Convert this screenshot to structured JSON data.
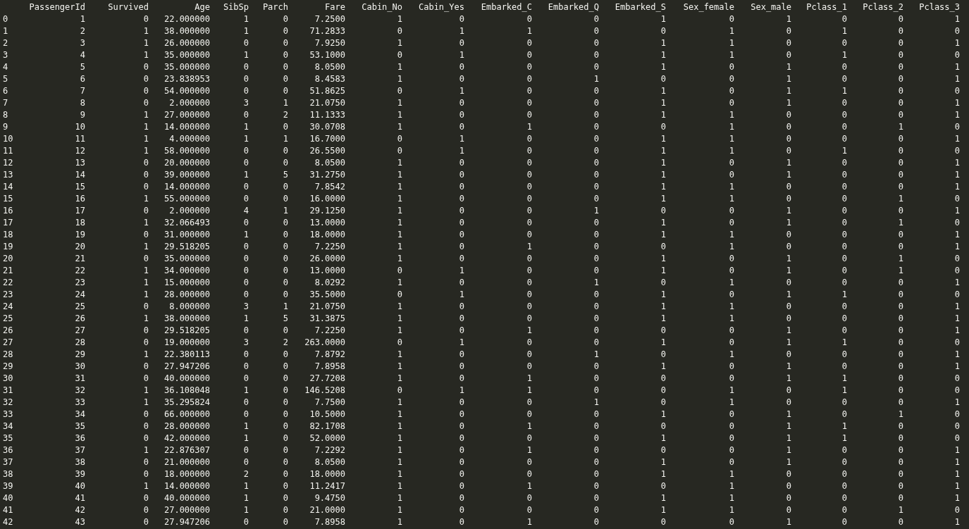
{
  "table": {
    "columns": [
      "PassengerId",
      "Survived",
      "Age",
      "SibSp",
      "Parch",
      "Fare",
      "Cabin_No",
      "Cabin_Yes",
      "Embarked_C",
      "Embarked_Q",
      "Embarked_S",
      "Sex_female",
      "Sex_male",
      "Pclass_1",
      "Pclass_2",
      "Pclass_3"
    ],
    "rows": [
      {
        "index": "0",
        "cells": [
          "1",
          "0",
          "22.000000",
          "1",
          "0",
          "7.2500",
          "1",
          "0",
          "0",
          "0",
          "1",
          "0",
          "1",
          "0",
          "0",
          "1"
        ]
      },
      {
        "index": "1",
        "cells": [
          "2",
          "1",
          "38.000000",
          "1",
          "0",
          "71.2833",
          "0",
          "1",
          "1",
          "0",
          "0",
          "1",
          "0",
          "1",
          "0",
          "0"
        ]
      },
      {
        "index": "2",
        "cells": [
          "3",
          "1",
          "26.000000",
          "0",
          "0",
          "7.9250",
          "1",
          "0",
          "0",
          "0",
          "1",
          "1",
          "0",
          "0",
          "0",
          "1"
        ]
      },
      {
        "index": "3",
        "cells": [
          "4",
          "1",
          "35.000000",
          "1",
          "0",
          "53.1000",
          "0",
          "1",
          "0",
          "0",
          "1",
          "1",
          "0",
          "1",
          "0",
          "0"
        ]
      },
      {
        "index": "4",
        "cells": [
          "5",
          "0",
          "35.000000",
          "0",
          "0",
          "8.0500",
          "1",
          "0",
          "0",
          "0",
          "1",
          "0",
          "1",
          "0",
          "0",
          "1"
        ]
      },
      {
        "index": "5",
        "cells": [
          "6",
          "0",
          "23.838953",
          "0",
          "0",
          "8.4583",
          "1",
          "0",
          "0",
          "1",
          "0",
          "0",
          "1",
          "0",
          "0",
          "1"
        ]
      },
      {
        "index": "6",
        "cells": [
          "7",
          "0",
          "54.000000",
          "0",
          "0",
          "51.8625",
          "0",
          "1",
          "0",
          "0",
          "1",
          "0",
          "1",
          "1",
          "0",
          "0"
        ]
      },
      {
        "index": "7",
        "cells": [
          "8",
          "0",
          "2.000000",
          "3",
          "1",
          "21.0750",
          "1",
          "0",
          "0",
          "0",
          "1",
          "0",
          "1",
          "0",
          "0",
          "1"
        ]
      },
      {
        "index": "8",
        "cells": [
          "9",
          "1",
          "27.000000",
          "0",
          "2",
          "11.1333",
          "1",
          "0",
          "0",
          "0",
          "1",
          "1",
          "0",
          "0",
          "0",
          "1"
        ]
      },
      {
        "index": "9",
        "cells": [
          "10",
          "1",
          "14.000000",
          "1",
          "0",
          "30.0708",
          "1",
          "0",
          "1",
          "0",
          "0",
          "1",
          "0",
          "0",
          "1",
          "0"
        ]
      },
      {
        "index": "10",
        "cells": [
          "11",
          "1",
          "4.000000",
          "1",
          "1",
          "16.7000",
          "0",
          "1",
          "0",
          "0",
          "1",
          "1",
          "0",
          "0",
          "0",
          "1"
        ]
      },
      {
        "index": "11",
        "cells": [
          "12",
          "1",
          "58.000000",
          "0",
          "0",
          "26.5500",
          "0",
          "1",
          "0",
          "0",
          "1",
          "1",
          "0",
          "1",
          "0",
          "0"
        ]
      },
      {
        "index": "12",
        "cells": [
          "13",
          "0",
          "20.000000",
          "0",
          "0",
          "8.0500",
          "1",
          "0",
          "0",
          "0",
          "1",
          "0",
          "1",
          "0",
          "0",
          "1"
        ]
      },
      {
        "index": "13",
        "cells": [
          "14",
          "0",
          "39.000000",
          "1",
          "5",
          "31.2750",
          "1",
          "0",
          "0",
          "0",
          "1",
          "0",
          "1",
          "0",
          "0",
          "1"
        ]
      },
      {
        "index": "14",
        "cells": [
          "15",
          "0",
          "14.000000",
          "0",
          "0",
          "7.8542",
          "1",
          "0",
          "0",
          "0",
          "1",
          "1",
          "0",
          "0",
          "0",
          "1"
        ]
      },
      {
        "index": "15",
        "cells": [
          "16",
          "1",
          "55.000000",
          "0",
          "0",
          "16.0000",
          "1",
          "0",
          "0",
          "0",
          "1",
          "1",
          "0",
          "0",
          "1",
          "0"
        ]
      },
      {
        "index": "16",
        "cells": [
          "17",
          "0",
          "2.000000",
          "4",
          "1",
          "29.1250",
          "1",
          "0",
          "0",
          "1",
          "0",
          "0",
          "1",
          "0",
          "0",
          "1"
        ]
      },
      {
        "index": "17",
        "cells": [
          "18",
          "1",
          "32.066493",
          "0",
          "0",
          "13.0000",
          "1",
          "0",
          "0",
          "0",
          "1",
          "0",
          "1",
          "0",
          "1",
          "0"
        ]
      },
      {
        "index": "18",
        "cells": [
          "19",
          "0",
          "31.000000",
          "1",
          "0",
          "18.0000",
          "1",
          "0",
          "0",
          "0",
          "1",
          "1",
          "0",
          "0",
          "0",
          "1"
        ]
      },
      {
        "index": "19",
        "cells": [
          "20",
          "1",
          "29.518205",
          "0",
          "0",
          "7.2250",
          "1",
          "0",
          "1",
          "0",
          "0",
          "1",
          "0",
          "0",
          "0",
          "1"
        ]
      },
      {
        "index": "20",
        "cells": [
          "21",
          "0",
          "35.000000",
          "0",
          "0",
          "26.0000",
          "1",
          "0",
          "0",
          "0",
          "1",
          "0",
          "1",
          "0",
          "1",
          "0"
        ]
      },
      {
        "index": "21",
        "cells": [
          "22",
          "1",
          "34.000000",
          "0",
          "0",
          "13.0000",
          "0",
          "1",
          "0",
          "0",
          "1",
          "0",
          "1",
          "0",
          "1",
          "0"
        ]
      },
      {
        "index": "22",
        "cells": [
          "23",
          "1",
          "15.000000",
          "0",
          "0",
          "8.0292",
          "1",
          "0",
          "0",
          "1",
          "0",
          "1",
          "0",
          "0",
          "0",
          "1"
        ]
      },
      {
        "index": "23",
        "cells": [
          "24",
          "1",
          "28.000000",
          "0",
          "0",
          "35.5000",
          "0",
          "1",
          "0",
          "0",
          "1",
          "0",
          "1",
          "1",
          "0",
          "0"
        ]
      },
      {
        "index": "24",
        "cells": [
          "25",
          "0",
          "8.000000",
          "3",
          "1",
          "21.0750",
          "1",
          "0",
          "0",
          "0",
          "1",
          "1",
          "0",
          "0",
          "0",
          "1"
        ]
      },
      {
        "index": "25",
        "cells": [
          "26",
          "1",
          "38.000000",
          "1",
          "5",
          "31.3875",
          "1",
          "0",
          "0",
          "0",
          "1",
          "1",
          "0",
          "0",
          "0",
          "1"
        ]
      },
      {
        "index": "26",
        "cells": [
          "27",
          "0",
          "29.518205",
          "0",
          "0",
          "7.2250",
          "1",
          "0",
          "1",
          "0",
          "0",
          "0",
          "1",
          "0",
          "0",
          "1"
        ]
      },
      {
        "index": "27",
        "cells": [
          "28",
          "0",
          "19.000000",
          "3",
          "2",
          "263.0000",
          "0",
          "1",
          "0",
          "0",
          "1",
          "0",
          "1",
          "1",
          "0",
          "0"
        ]
      },
      {
        "index": "28",
        "cells": [
          "29",
          "1",
          "22.380113",
          "0",
          "0",
          "7.8792",
          "1",
          "0",
          "0",
          "1",
          "0",
          "1",
          "0",
          "0",
          "0",
          "1"
        ]
      },
      {
        "index": "29",
        "cells": [
          "30",
          "0",
          "27.947206",
          "0",
          "0",
          "7.8958",
          "1",
          "0",
          "0",
          "0",
          "1",
          "0",
          "1",
          "0",
          "0",
          "1"
        ]
      },
      {
        "index": "30",
        "cells": [
          "31",
          "0",
          "40.000000",
          "0",
          "0",
          "27.7208",
          "1",
          "0",
          "1",
          "0",
          "0",
          "0",
          "1",
          "1",
          "0",
          "0"
        ]
      },
      {
        "index": "31",
        "cells": [
          "32",
          "1",
          "36.108048",
          "1",
          "0",
          "146.5208",
          "0",
          "1",
          "1",
          "0",
          "0",
          "1",
          "0",
          "1",
          "0",
          "0"
        ]
      },
      {
        "index": "32",
        "cells": [
          "33",
          "1",
          "35.295824",
          "0",
          "0",
          "7.7500",
          "1",
          "0",
          "0",
          "1",
          "0",
          "1",
          "0",
          "0",
          "0",
          "1"
        ]
      },
      {
        "index": "33",
        "cells": [
          "34",
          "0",
          "66.000000",
          "0",
          "0",
          "10.5000",
          "1",
          "0",
          "0",
          "0",
          "1",
          "0",
          "1",
          "0",
          "1",
          "0"
        ]
      },
      {
        "index": "34",
        "cells": [
          "35",
          "0",
          "28.000000",
          "1",
          "0",
          "82.1708",
          "1",
          "0",
          "1",
          "0",
          "0",
          "0",
          "1",
          "1",
          "0",
          "0"
        ]
      },
      {
        "index": "35",
        "cells": [
          "36",
          "0",
          "42.000000",
          "1",
          "0",
          "52.0000",
          "1",
          "0",
          "0",
          "0",
          "1",
          "0",
          "1",
          "1",
          "0",
          "0"
        ]
      },
      {
        "index": "36",
        "cells": [
          "37",
          "1",
          "22.876307",
          "0",
          "0",
          "7.2292",
          "1",
          "0",
          "1",
          "0",
          "0",
          "0",
          "1",
          "0",
          "0",
          "1"
        ]
      },
      {
        "index": "37",
        "cells": [
          "38",
          "0",
          "21.000000",
          "0",
          "0",
          "8.0500",
          "1",
          "0",
          "0",
          "0",
          "1",
          "0",
          "1",
          "0",
          "0",
          "1"
        ]
      },
      {
        "index": "38",
        "cells": [
          "39",
          "0",
          "18.000000",
          "2",
          "0",
          "18.0000",
          "1",
          "0",
          "0",
          "0",
          "1",
          "1",
          "0",
          "0",
          "0",
          "1"
        ]
      },
      {
        "index": "39",
        "cells": [
          "40",
          "1",
          "14.000000",
          "1",
          "0",
          "11.2417",
          "1",
          "0",
          "1",
          "0",
          "0",
          "1",
          "0",
          "0",
          "0",
          "1"
        ]
      },
      {
        "index": "40",
        "cells": [
          "41",
          "0",
          "40.000000",
          "1",
          "0",
          "9.4750",
          "1",
          "0",
          "0",
          "0",
          "1",
          "1",
          "0",
          "0",
          "0",
          "1"
        ]
      },
      {
        "index": "41",
        "cells": [
          "42",
          "0",
          "27.000000",
          "1",
          "0",
          "21.0000",
          "1",
          "0",
          "0",
          "0",
          "1",
          "1",
          "0",
          "0",
          "1",
          "0"
        ]
      },
      {
        "index": "42",
        "cells": [
          "43",
          "0",
          "27.947206",
          "0",
          "0",
          "7.8958",
          "1",
          "0",
          "1",
          "0",
          "0",
          "0",
          "1",
          "0",
          "0",
          "1"
        ]
      }
    ]
  }
}
